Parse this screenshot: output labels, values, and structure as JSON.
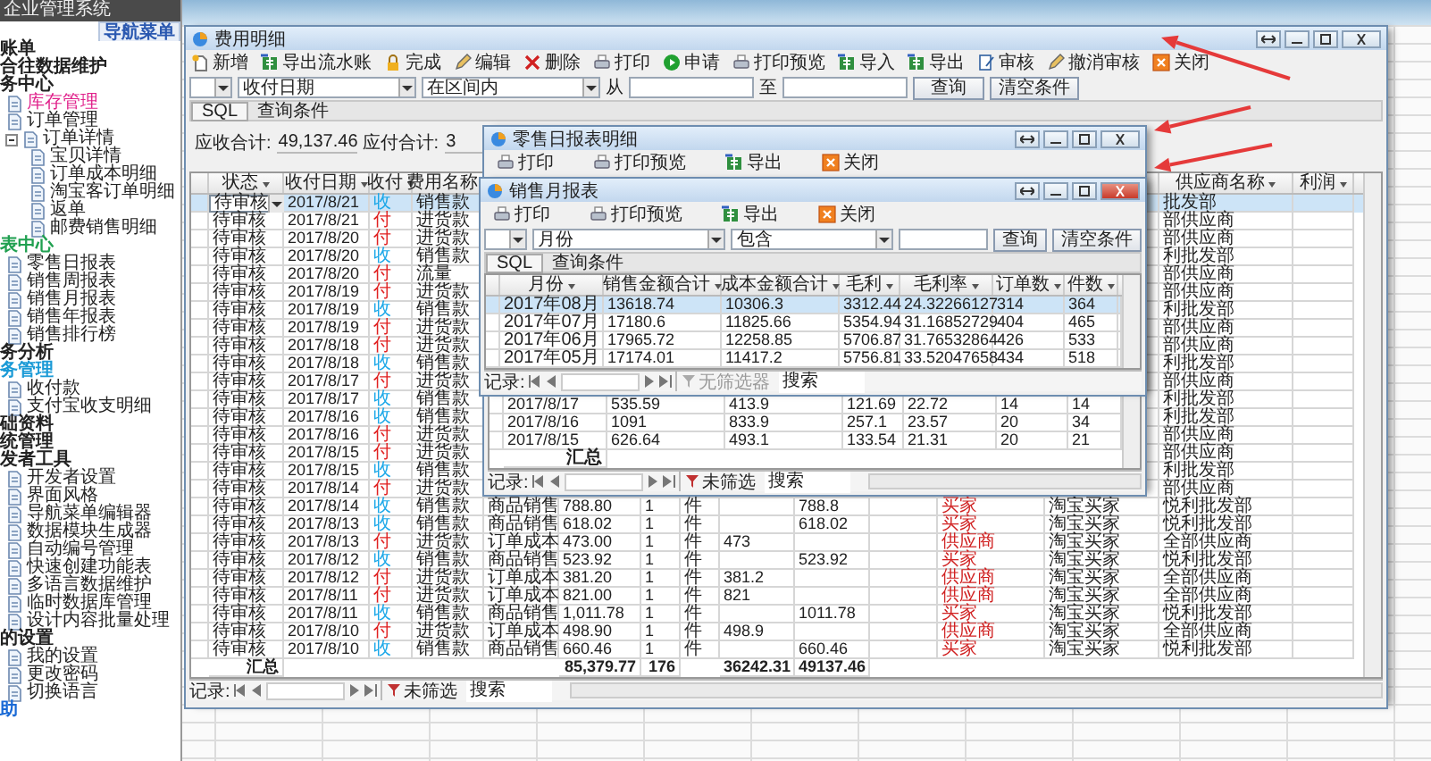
{
  "app_title": "企业管理系统",
  "nav_tab": "导航菜单",
  "sidebar": {
    "items": [
      {
        "label": "账单"
      },
      {
        "label": "合往数据维护"
      },
      {
        "label": "务中心",
        "children": [
          {
            "label": "库存管理",
            "color": "#e0208a"
          },
          {
            "label": "订单管理"
          },
          {
            "label": "订单详情",
            "expanded": true,
            "children": [
              {
                "label": "宝贝详情"
              },
              {
                "label": "订单成本明细"
              },
              {
                "label": "淘宝客订单明细"
              },
              {
                "label": "返单"
              },
              {
                "label": "邮费销售明细"
              }
            ]
          }
        ]
      },
      {
        "label": "表中心",
        "color": "#20a050",
        "children": [
          {
            "label": "零售日报表"
          },
          {
            "label": "销售周报表"
          },
          {
            "label": "销售月报表"
          },
          {
            "label": "销售年报表"
          },
          {
            "label": "销售排行榜"
          }
        ]
      },
      {
        "label": "务分析"
      },
      {
        "label": "务管理",
        "color": "#1a9ad6",
        "children": [
          {
            "label": "收付款"
          },
          {
            "label": "支付宝收支明细"
          }
        ]
      },
      {
        "label": "础资料"
      },
      {
        "label": "统管理"
      },
      {
        "label": "发者工具",
        "children": [
          {
            "label": "开发者设置"
          },
          {
            "label": "界面风格"
          },
          {
            "label": "导航菜单编辑器"
          },
          {
            "label": "数据模块生成器"
          },
          {
            "label": "自动编号管理"
          },
          {
            "label": "快速创建功能表"
          },
          {
            "label": "多语言数据维护"
          },
          {
            "label": "临时数据库管理"
          },
          {
            "label": "设计内容批量处理"
          }
        ]
      },
      {
        "label": "的设置",
        "children": [
          {
            "label": "我的设置"
          },
          {
            "label": "更改密码"
          },
          {
            "label": "切换语言"
          }
        ]
      },
      {
        "label": "助",
        "color": "#1a6ad6"
      }
    ]
  },
  "main_window": {
    "title": "费用明细",
    "active": false,
    "toolbar": [
      {
        "label": "新增",
        "kind": "new"
      },
      {
        "label": "导出流水账",
        "kind": "export"
      },
      {
        "label": "完成",
        "kind": "done"
      },
      {
        "label": "编辑",
        "kind": "edit"
      },
      {
        "label": "删除",
        "kind": "delete"
      },
      {
        "label": "打印",
        "kind": "print"
      },
      {
        "label": "申请",
        "kind": "apply"
      },
      {
        "label": "打印预览",
        "kind": "print"
      },
      {
        "label": "导入",
        "kind": "export"
      },
      {
        "label": "导出",
        "kind": "export"
      },
      {
        "label": "审核",
        "kind": "audit"
      },
      {
        "label": "撤消审核",
        "kind": "edit"
      },
      {
        "label": "关闭",
        "kind": "close"
      }
    ],
    "filter": {
      "field": "收付日期",
      "operator": "在区间内",
      "from_label": "从",
      "to_label": "至",
      "query": "查询",
      "clear": "清空条件"
    },
    "sql_tab": "SQL",
    "conditions": "查询条件",
    "summary": [
      {
        "label": "应收合计:",
        "value": "49,137.46"
      },
      {
        "label": "应付合计:",
        "value": "3"
      }
    ],
    "columns": {
      "status": "状态",
      "date": "收付日期",
      "direction": "收付",
      "fee_name": "费用名称",
      "supplier": "供应商名称",
      "profit": "利润"
    },
    "rows": [
      {
        "status": "待审核",
        "date": "2017/8/21",
        "direction": "收",
        "color": "#1aa7e8",
        "fee_name": "销售款",
        "supplier": "批发部",
        "selected": true
      },
      {
        "status": "待审核",
        "date": "2017/8/21",
        "direction": "付",
        "color": "#e02020",
        "fee_name": "进货款",
        "supplier": "部供应商",
        "selected": false
      },
      {
        "status": "待审核",
        "date": "2017/8/20",
        "direction": "付",
        "color": "#e02020",
        "fee_name": "进货款",
        "supplier": "部供应商",
        "selected": false
      },
      {
        "status": "待审核",
        "date": "2017/8/20",
        "direction": "收",
        "color": "#1aa7e8",
        "fee_name": "销售款",
        "supplier": "利批发部",
        "selected": false
      },
      {
        "status": "待审核",
        "date": "2017/8/20",
        "direction": "付",
        "color": "#e02020",
        "fee_name": "流量",
        "supplier": "部供应商",
        "selected": false
      },
      {
        "status": "待审核",
        "date": "2017/8/19",
        "direction": "付",
        "color": "#e02020",
        "fee_name": "进货款",
        "supplier": "部供应商",
        "selected": false
      },
      {
        "status": "待审核",
        "date": "2017/8/19",
        "direction": "收",
        "color": "#1aa7e8",
        "fee_name": "销售款",
        "supplier": "利批发部",
        "selected": false
      },
      {
        "status": "待审核",
        "date": "2017/8/19",
        "direction": "付",
        "color": "#e02020",
        "fee_name": "进货款",
        "supplier": "部供应商",
        "selected": false
      },
      {
        "status": "待审核",
        "date": "2017/8/18",
        "direction": "付",
        "color": "#e02020",
        "fee_name": "进货款",
        "supplier": "部供应商",
        "selected": false
      },
      {
        "status": "待审核",
        "date": "2017/8/18",
        "direction": "收",
        "color": "#1aa7e8",
        "fee_name": "销售款",
        "supplier": "利批发部",
        "selected": false
      },
      {
        "status": "待审核",
        "date": "2017/8/17",
        "direction": "付",
        "color": "#e02020",
        "fee_name": "进货款",
        "supplier": "部供应商",
        "selected": false
      },
      {
        "status": "待审核",
        "date": "2017/8/17",
        "direction": "收",
        "color": "#1aa7e8",
        "fee_name": "销售款",
        "supplier": "利批发部",
        "selected": false
      },
      {
        "status": "待审核",
        "date": "2017/8/16",
        "direction": "收",
        "color": "#1aa7e8",
        "fee_name": "销售款",
        "supplier": "利批发部",
        "selected": false
      },
      {
        "status": "待审核",
        "date": "2017/8/16",
        "direction": "付",
        "color": "#e02020",
        "fee_name": "进货款",
        "supplier": "部供应商",
        "selected": false
      },
      {
        "status": "待审核",
        "date": "2017/8/15",
        "direction": "付",
        "color": "#e02020",
        "fee_name": "进货款",
        "supplier": "部供应商",
        "selected": false
      },
      {
        "status": "待审核",
        "date": "2017/8/15",
        "direction": "收",
        "color": "#1aa7e8",
        "fee_name": "销售款",
        "supplier": "利批发部",
        "selected": false
      },
      {
        "status": "待审核",
        "date": "2017/8/14",
        "direction": "付",
        "color": "#e02020",
        "fee_name": "进货款",
        "supplier": "部供应商",
        "selected": false
      },
      {
        "status": "待审核",
        "date": "2017/8/14",
        "direction": "收",
        "color": "#1aa7e8",
        "fee_name": "销售款",
        "column_5": "商品销售",
        "amount": "788.80",
        "qty": "1",
        "unit": "件",
        "sales": "788.8",
        "category": "买家",
        "buyer": "淘宝买家",
        "supplier": "悦利批发部",
        "selected": false
      },
      {
        "status": "待审核",
        "date": "2017/8/13",
        "direction": "收",
        "color": "#1aa7e8",
        "fee_name": "销售款",
        "column_5": "商品销售",
        "amount": "618.02",
        "qty": "1",
        "unit": "件",
        "sales": "618.02",
        "category": "买家",
        "buyer": "淘宝买家",
        "supplier": "悦利批发部",
        "selected": false
      },
      {
        "status": "待审核",
        "date": "2017/8/13",
        "direction": "付",
        "color": "#e02020",
        "fee_name": "进货款",
        "column_5": "订单成本",
        "amount": "473.00",
        "qty": "1",
        "unit": "件",
        "cost": "473",
        "category": "供应商",
        "buyer": "淘宝买家",
        "supplier": "全部供应商",
        "selected": false
      },
      {
        "status": "待审核",
        "date": "2017/8/12",
        "direction": "收",
        "color": "#1aa7e8",
        "fee_name": "销售款",
        "column_5": "商品销售",
        "amount": "523.92",
        "qty": "1",
        "unit": "件",
        "sales": "523.92",
        "category": "买家",
        "buyer": "淘宝买家",
        "supplier": "悦利批发部",
        "selected": false
      },
      {
        "status": "待审核",
        "date": "2017/8/12",
        "direction": "付",
        "color": "#e02020",
        "fee_name": "进货款",
        "column_5": "订单成本",
        "amount": "381.20",
        "qty": "1",
        "unit": "件",
        "cost": "381.2",
        "category": "供应商",
        "buyer": "淘宝买家",
        "supplier": "全部供应商",
        "selected": false
      },
      {
        "status": "待审核",
        "date": "2017/8/11",
        "direction": "付",
        "color": "#e02020",
        "fee_name": "进货款",
        "column_5": "订单成本",
        "amount": "821.00",
        "qty": "1",
        "unit": "件",
        "cost": "821",
        "category": "供应商",
        "buyer": "淘宝买家",
        "supplier": "全部供应商",
        "selected": false
      },
      {
        "status": "待审核",
        "date": "2017/8/11",
        "direction": "收",
        "color": "#1aa7e8",
        "fee_name": "销售款",
        "column_5": "商品销售",
        "amount": "1,011.78",
        "qty": "1",
        "unit": "件",
        "sales": "1011.78",
        "category": "买家",
        "buyer": "淘宝买家",
        "supplier": "悦利批发部",
        "selected": false
      },
      {
        "status": "待审核",
        "date": "2017/8/10",
        "direction": "付",
        "color": "#e02020",
        "fee_name": "进货款",
        "column_5": "订单成本",
        "amount": "498.90",
        "qty": "1",
        "unit": "件",
        "cost": "498.9",
        "category": "供应商",
        "buyer": "淘宝买家",
        "supplier": "全部供应商",
        "selected": false
      },
      {
        "status": "待审核",
        "date": "2017/8/10",
        "direction": "收",
        "color": "#1aa7e8",
        "fee_name": "销售款",
        "column_5": "商品销售",
        "amount": "660.46",
        "qty": "1",
        "unit": "件",
        "sales": "660.46",
        "category": "买家",
        "buyer": "淘宝买家",
        "supplier": "悦利批发部",
        "selected": false
      }
    ],
    "totals": {
      "status": "汇总",
      "amount": "85,379.77",
      "qty": "176",
      "cost": "36242.31",
      "sales": "49137.46"
    },
    "nav": {
      "label": "记录:",
      "filter": "未筛选",
      "filter_disabled": false,
      "search": {
        "placeholder": "搜索"
      }
    }
  },
  "daily_window": {
    "title": "零售日报表明细",
    "active": false,
    "toolbar": [
      {
        "label": "打印",
        "kind": "print"
      },
      {
        "label": "打印预览",
        "kind": "print"
      },
      {
        "label": "导出",
        "kind": "export"
      },
      {
        "label": "关闭",
        "kind": "close"
      }
    ],
    "rows": [
      {
        "cells": [
          "2017/8/17",
          "535.59",
          "413.9",
          "121.69",
          "22.72",
          "14",
          "14"
        ]
      },
      {
        "cells": [
          "2017/8/16",
          "1091",
          "833.9",
          "257.1",
          "23.57",
          "20",
          "34"
        ]
      },
      {
        "cells": [
          "2017/8/15",
          "626.64",
          "493.1",
          "133.54",
          "21.31",
          "20",
          "21"
        ]
      }
    ],
    "total_label": "汇总",
    "nav": {
      "label": "记录:",
      "filter": "未筛选",
      "filter_disabled": false,
      "search": {
        "placeholder": "搜索"
      }
    }
  },
  "monthly_window": {
    "title": "销售月报表",
    "active": true,
    "toolbar": [
      {
        "label": "打印",
        "kind": "print"
      },
      {
        "label": "打印预览",
        "kind": "print"
      },
      {
        "label": "导出",
        "kind": "export"
      },
      {
        "label": "关闭",
        "kind": "close"
      }
    ],
    "filter": {
      "field": "月份",
      "operator": "包含",
      "query": "查询",
      "clear": "清空条件"
    },
    "sql_tab": "SQL",
    "conditions": "查询条件",
    "columns": [
      "月份",
      "销售金额合计",
      "成本金额合计",
      "毛利",
      "毛利率",
      "订单数",
      "件数"
    ],
    "rows": [
      {
        "selected": true,
        "cells": [
          "2017年08月",
          "13618.74",
          "10306.3",
          "3312.44",
          "24.32266127",
          "314",
          "364"
        ]
      },
      {
        "selected": false,
        "cells": [
          "2017年07月",
          "17180.6",
          "11825.66",
          "5354.94",
          "31.16852729",
          "404",
          "465"
        ]
      },
      {
        "selected": false,
        "cells": [
          "2017年06月",
          "17965.72",
          "12258.85",
          "5706.87",
          "31.76532864",
          "426",
          "533"
        ]
      },
      {
        "selected": false,
        "cells": [
          "2017年05月",
          "17174.01",
          "11417.2",
          "5756.81",
          "33.52047658",
          "434",
          "518"
        ]
      }
    ],
    "nav": {
      "label": "记录:",
      "filter": "无筛选器",
      "filter_disabled": true,
      "search": {
        "placeholder": "搜索"
      }
    }
  }
}
